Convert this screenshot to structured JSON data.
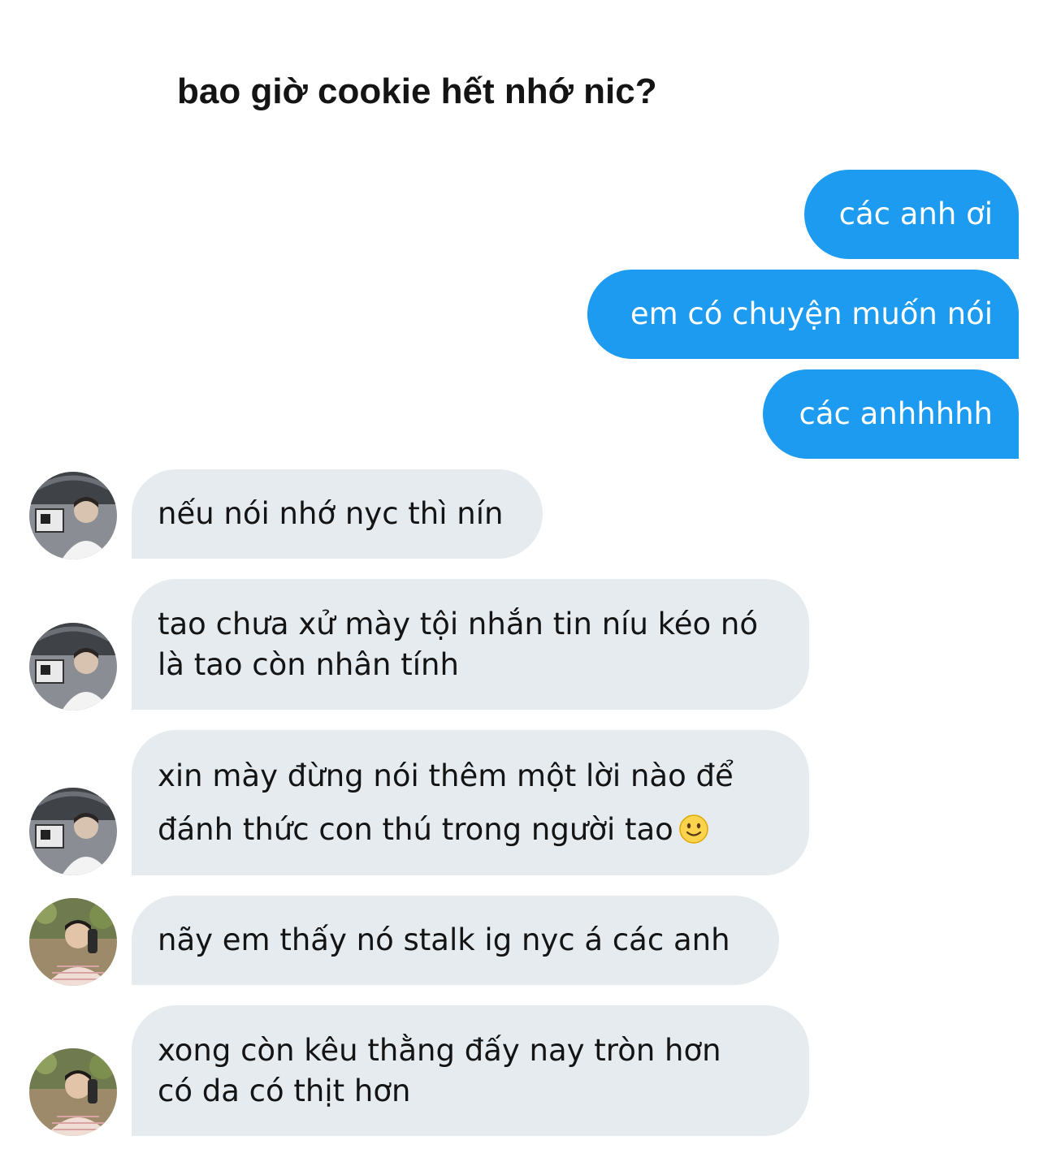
{
  "title": "bao giờ cookie hết nhớ nic?",
  "sent": [
    {
      "text": "các anh ơi"
    },
    {
      "text": "em có chuyện muốn nói"
    },
    {
      "text": "các anhhhhh"
    }
  ],
  "received": [
    {
      "lines": [
        "nếu nói nhớ nyc thì nín"
      ],
      "avatar": "avatar-1"
    },
    {
      "lines": [
        "tao chưa xử mày tội nhắn tin níu kéo nó",
        "là tao còn nhân tính"
      ],
      "avatar": "avatar-1"
    },
    {
      "lines": [
        "xin mày đừng nói thêm một lời nào để",
        "đánh thức con thú trong người tao"
      ],
      "emoji": "slightly-smiling-face-icon",
      "avatar": "avatar-1"
    },
    {
      "lines": [
        "nãy em thấy nó stalk ig nyc á các anh"
      ],
      "avatar": "avatar-2"
    },
    {
      "lines": [
        "xong còn kêu thằng đấy nay tròn hơn",
        "có da có thịt hơn"
      ],
      "avatar": "avatar-2"
    }
  ],
  "colors": {
    "sent_bubble": "#1d9bf0",
    "received_bubble": "#e6ebf0",
    "text": "#141414"
  }
}
